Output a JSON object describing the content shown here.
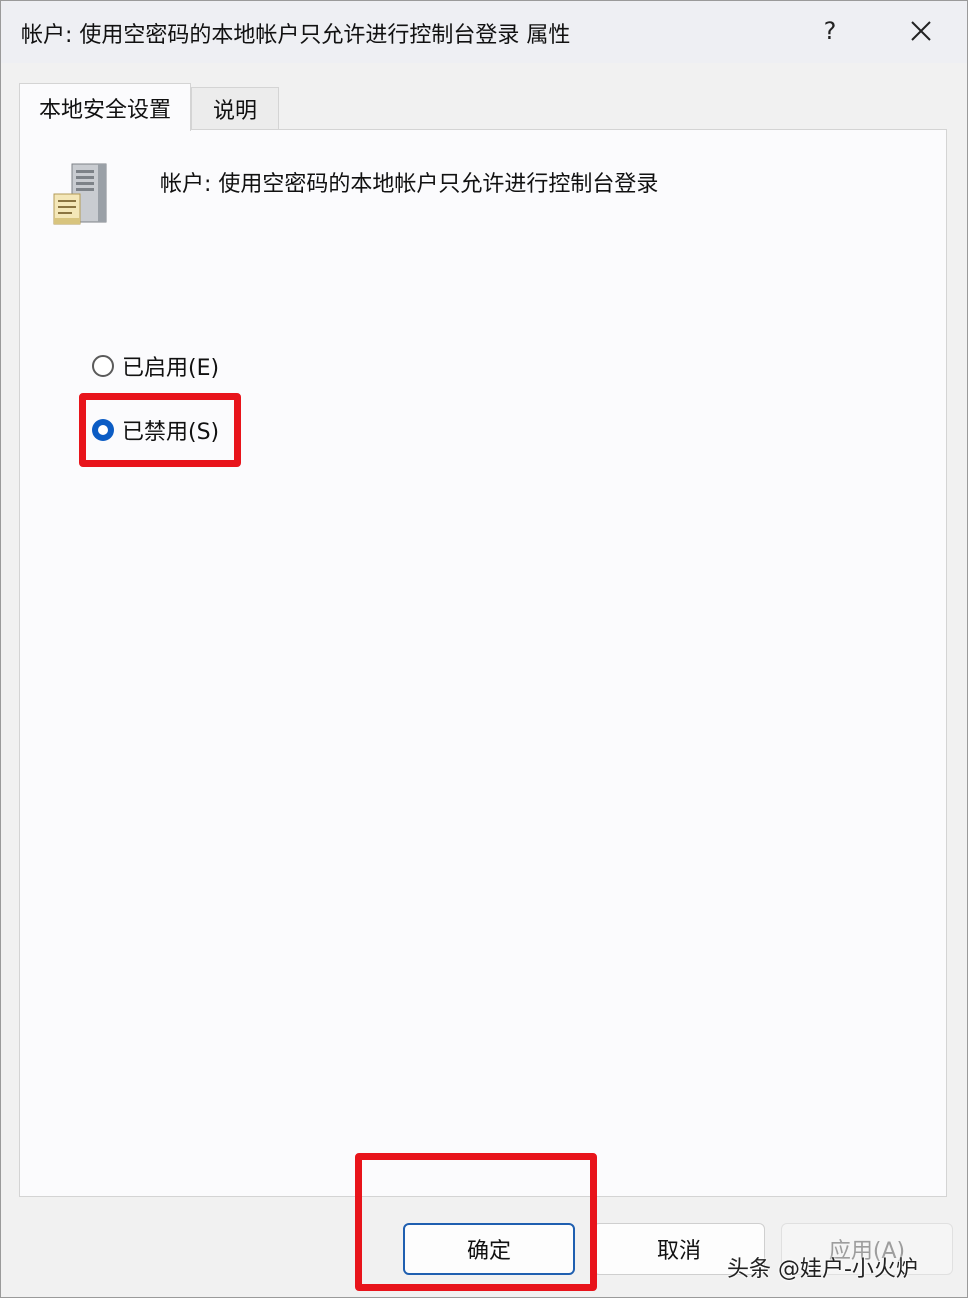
{
  "window": {
    "title": "帐户: 使用空密码的本地帐户只允许进行控制台登录 属性",
    "help_label": "?"
  },
  "tabs": [
    {
      "label": "本地安全设置",
      "active": true
    },
    {
      "label": "说明",
      "active": false
    }
  ],
  "policy": {
    "icon": "server-policy-icon",
    "title": "帐户: 使用空密码的本地帐户只允许进行控制台登录"
  },
  "options": {
    "enabled_label": "已启用(E)",
    "disabled_label": "已禁用(S)",
    "selected": "disabled"
  },
  "buttons": {
    "ok": "确定",
    "cancel": "取消",
    "apply": "应用(A)"
  },
  "watermark": "头条 @娃户-小火炉",
  "colors": {
    "accent": "#0b5cc4",
    "highlight": "#e8141b"
  }
}
